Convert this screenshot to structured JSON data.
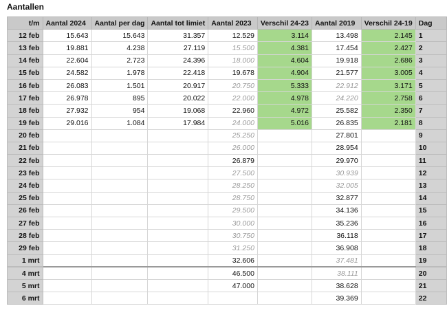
{
  "title": "Aantallen",
  "columns": [
    "t/m",
    "Aantal 2024",
    "Aantal per dag",
    "Aantal tot limiet",
    "Aantal 2023",
    "Verschil 24-23",
    "Aantal 2019",
    "Verschil 24-19",
    "Dag"
  ],
  "rows": [
    {
      "date": "12 feb",
      "a2024": "15.643",
      "per_dag": "15.643",
      "tot_limiet": "31.357",
      "a2023": "12.529",
      "a2023_est": false,
      "v2423": "3.114",
      "a2019": "13.498",
      "a2019_est": false,
      "v2419": "2.145",
      "dag": "1"
    },
    {
      "date": "13 feb",
      "a2024": "19.881",
      "per_dag": "4.238",
      "tot_limiet": "27.119",
      "a2023": "15.500",
      "a2023_est": true,
      "v2423": "4.381",
      "a2019": "17.454",
      "a2019_est": false,
      "v2419": "2.427",
      "dag": "2"
    },
    {
      "date": "14 feb",
      "a2024": "22.604",
      "per_dag": "2.723",
      "tot_limiet": "24.396",
      "a2023": "18.000",
      "a2023_est": true,
      "v2423": "4.604",
      "a2019": "19.918",
      "a2019_est": false,
      "v2419": "2.686",
      "dag": "3"
    },
    {
      "date": "15 feb",
      "a2024": "24.582",
      "per_dag": "1.978",
      "tot_limiet": "22.418",
      "a2023": "19.678",
      "a2023_est": false,
      "v2423": "4.904",
      "a2019": "21.577",
      "a2019_est": false,
      "v2419": "3.005",
      "dag": "4"
    },
    {
      "date": "16 feb",
      "a2024": "26.083",
      "per_dag": "1.501",
      "tot_limiet": "20.917",
      "a2023": "20.750",
      "a2023_est": true,
      "v2423": "5.333",
      "a2019": "22.912",
      "a2019_est": true,
      "v2419": "3.171",
      "dag": "5"
    },
    {
      "date": "17 feb",
      "a2024": "26.978",
      "per_dag": "895",
      "tot_limiet": "20.022",
      "a2023": "22.000",
      "a2023_est": true,
      "v2423": "4.978",
      "a2019": "24.220",
      "a2019_est": true,
      "v2419": "2.758",
      "dag": "6"
    },
    {
      "date": "18 feb",
      "a2024": "27.932",
      "per_dag": "954",
      "tot_limiet": "19.068",
      "a2023": "22.960",
      "a2023_est": false,
      "v2423": "4.972",
      "a2019": "25.582",
      "a2019_est": false,
      "v2419": "2.350",
      "dag": "7"
    },
    {
      "date": "19 feb",
      "a2024": "29.016",
      "per_dag": "1.084",
      "tot_limiet": "17.984",
      "a2023": "24.000",
      "a2023_est": true,
      "v2423": "5.016",
      "a2019": "26.835",
      "a2019_est": false,
      "v2419": "2.181",
      "dag": "8"
    },
    {
      "date": "20 feb",
      "a2024": "",
      "per_dag": "",
      "tot_limiet": "",
      "a2023": "25.250",
      "a2023_est": true,
      "v2423": "",
      "a2019": "27.801",
      "a2019_est": false,
      "v2419": "",
      "dag": "9"
    },
    {
      "date": "21 feb",
      "a2024": "",
      "per_dag": "",
      "tot_limiet": "",
      "a2023": "26.000",
      "a2023_est": true,
      "v2423": "",
      "a2019": "28.954",
      "a2019_est": false,
      "v2419": "",
      "dag": "10"
    },
    {
      "date": "22 feb",
      "a2024": "",
      "per_dag": "",
      "tot_limiet": "",
      "a2023": "26.879",
      "a2023_est": false,
      "v2423": "",
      "a2019": "29.970",
      "a2019_est": false,
      "v2419": "",
      "dag": "11"
    },
    {
      "date": "23 feb",
      "a2024": "",
      "per_dag": "",
      "tot_limiet": "",
      "a2023": "27.500",
      "a2023_est": true,
      "v2423": "",
      "a2019": "30.939",
      "a2019_est": true,
      "v2419": "",
      "dag": "12"
    },
    {
      "date": "24 feb",
      "a2024": "",
      "per_dag": "",
      "tot_limiet": "",
      "a2023": "28.250",
      "a2023_est": true,
      "v2423": "",
      "a2019": "32.005",
      "a2019_est": true,
      "v2419": "",
      "dag": "13"
    },
    {
      "date": "25 feb",
      "a2024": "",
      "per_dag": "",
      "tot_limiet": "",
      "a2023": "28.750",
      "a2023_est": true,
      "v2423": "",
      "a2019": "32.877",
      "a2019_est": false,
      "v2419": "",
      "dag": "14"
    },
    {
      "date": "26 feb",
      "a2024": "",
      "per_dag": "",
      "tot_limiet": "",
      "a2023": "29.500",
      "a2023_est": true,
      "v2423": "",
      "a2019": "34.136",
      "a2019_est": false,
      "v2419": "",
      "dag": "15"
    },
    {
      "date": "27 feb",
      "a2024": "",
      "per_dag": "",
      "tot_limiet": "",
      "a2023": "30.000",
      "a2023_est": true,
      "v2423": "",
      "a2019": "35.236",
      "a2019_est": false,
      "v2419": "",
      "dag": "16"
    },
    {
      "date": "28 feb",
      "a2024": "",
      "per_dag": "",
      "tot_limiet": "",
      "a2023": "30.750",
      "a2023_est": true,
      "v2423": "",
      "a2019": "36.118",
      "a2019_est": false,
      "v2419": "",
      "dag": "17"
    },
    {
      "date": "29 feb",
      "a2024": "",
      "per_dag": "",
      "tot_limiet": "",
      "a2023": "31.250",
      "a2023_est": true,
      "v2423": "",
      "a2019": "36.908",
      "a2019_est": false,
      "v2419": "",
      "dag": "18"
    },
    {
      "date": "1 mrt",
      "a2024": "",
      "per_dag": "",
      "tot_limiet": "",
      "a2023": "32.606",
      "a2023_est": false,
      "v2423": "",
      "a2019": "37.481",
      "a2019_est": true,
      "v2419": "",
      "dag": "19"
    },
    {
      "date": "4 mrt",
      "a2024": "",
      "per_dag": "",
      "tot_limiet": "",
      "a2023": "46.500",
      "a2023_est": false,
      "v2423": "",
      "a2019": "38.111",
      "a2019_est": true,
      "v2419": "",
      "dag": "20",
      "gap": true
    },
    {
      "date": "5 mrt",
      "a2024": "",
      "per_dag": "",
      "tot_limiet": "",
      "a2023": "47.000",
      "a2023_est": false,
      "v2423": "",
      "a2019": "38.628",
      "a2019_est": false,
      "v2419": "",
      "dag": "21"
    },
    {
      "date": "6 mrt",
      "a2024": "",
      "per_dag": "",
      "tot_limiet": "",
      "a2023": "",
      "a2023_est": false,
      "v2423": "",
      "a2019": "39.369",
      "a2019_est": false,
      "v2419": "",
      "dag": "22"
    }
  ],
  "colors": {
    "green": "#a6d88c",
    "header": "#c9c9c9",
    "estimate_text": "#9a9a9a"
  }
}
